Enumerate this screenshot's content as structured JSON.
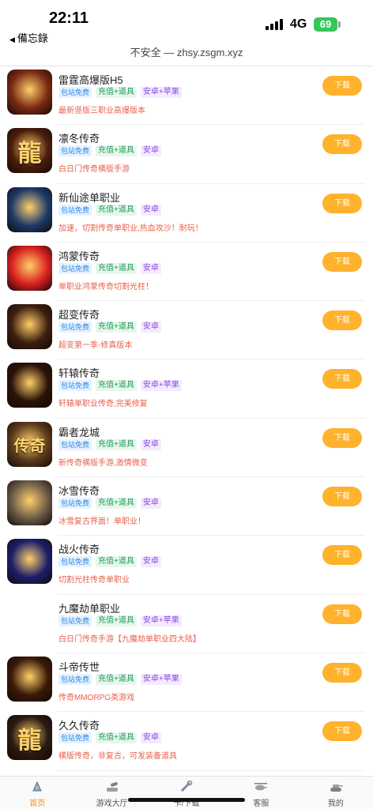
{
  "status": {
    "time": "22:11",
    "back_label": "備忘錄",
    "network": "4G",
    "battery": "69"
  },
  "browser": {
    "url_text": "不安全 — zhsy.zsgm.xyz"
  },
  "games": [
    {
      "name": "雷霆高爆版H5",
      "tags": [
        "包站免费",
        "充值+道具",
        "安卓+苹果"
      ],
      "desc": "最新竖版三职业高爆版本",
      "download": "下载",
      "icon_glyph": "",
      "icon_bg": "#7a2a12"
    },
    {
      "name": "凛冬传奇",
      "tags": [
        "包站免费",
        "充值+道具",
        "安卓"
      ],
      "desc": "白日门传奇横版手游",
      "download": "下载",
      "icon_glyph": "龍",
      "icon_bg": "#4a1d0c"
    },
    {
      "name": "新仙途单职业",
      "tags": [
        "包站免费",
        "充值+道具",
        "安卓"
      ],
      "desc": "加速，切割传奇单职业,热血攻沙！耐玩！",
      "download": "下载",
      "icon_glyph": "",
      "icon_bg": "#1e3a6a"
    },
    {
      "name": "鸿蒙传奇",
      "tags": [
        "包站免费",
        "充值+道具",
        "安卓"
      ],
      "desc": "单职业鸿蒙传奇切割光柱！",
      "download": "下载",
      "icon_glyph": "",
      "icon_bg": "#d81f1f"
    },
    {
      "name": "超变传奇",
      "tags": [
        "包站免费",
        "充值+道具",
        "安卓"
      ],
      "desc": "超变第一季-修真版本",
      "download": "下载",
      "icon_glyph": "",
      "icon_bg": "#3d1f10"
    },
    {
      "name": "轩辕传奇",
      "tags": [
        "包站免费",
        "充值+道具",
        "安卓+苹果"
      ],
      "desc": "轩辕单职业传奇,完美修复",
      "download": "下载",
      "icon_glyph": "",
      "icon_bg": "#2a1308"
    },
    {
      "name": "霸者龙城",
      "tags": [
        "包站免费",
        "充值+道具",
        "安卓"
      ],
      "desc": "新传奇横版手游,激情微变",
      "download": "下载",
      "icon_glyph": "传奇",
      "icon_bg": "#5a3a1a"
    },
    {
      "name": "冰雪传奇",
      "tags": [
        "包站免费",
        "充值+道具",
        "安卓"
      ],
      "desc": "冰雪复古界面！单职业！",
      "download": "下载",
      "icon_glyph": "",
      "icon_bg": "#6a5a48"
    },
    {
      "name": "战火传奇",
      "tags": [
        "包站免费",
        "充值+道具",
        "安卓"
      ],
      "desc": "切割光柱传奇单职业",
      "download": "下载",
      "icon_glyph": "",
      "icon_bg": "#1c1f6a"
    },
    {
      "name": "九魔劫单职业",
      "tags": [
        "包站免费",
        "充值+道具",
        "安卓+苹果"
      ],
      "desc": "白日门传奇手游【九魔劫单职业四大陆】",
      "download": "下载",
      "icon_glyph": "",
      "icon_bg": "#ffffff"
    },
    {
      "name": "斗帝传世",
      "tags": [
        "包站免费",
        "充值+道具",
        "安卓+苹果"
      ],
      "desc": "传奇MMORPG类游戏",
      "download": "下载",
      "icon_glyph": "",
      "icon_bg": "#3a1a08"
    },
    {
      "name": "久久传奇",
      "tags": [
        "包站免费",
        "充值+道具",
        "安卓"
      ],
      "desc": "横版传奇，非复古，可发装备道具",
      "download": "下载",
      "icon_glyph": "龍",
      "icon_bg": "#2a1a10"
    }
  ],
  "tabs": [
    {
      "label": "首页",
      "icon": "home-icon"
    },
    {
      "label": "游戏大厅",
      "icon": "cannon-icon"
    },
    {
      "label": "卡/下载",
      "icon": "wrench-icon"
    },
    {
      "label": "客服",
      "icon": "helicopter-icon"
    },
    {
      "label": "我的",
      "icon": "tank-icon"
    }
  ],
  "colors": {
    "accent": "#ffb22c",
    "active_tab": "#ff8a1a",
    "desc": "#e8604c"
  }
}
